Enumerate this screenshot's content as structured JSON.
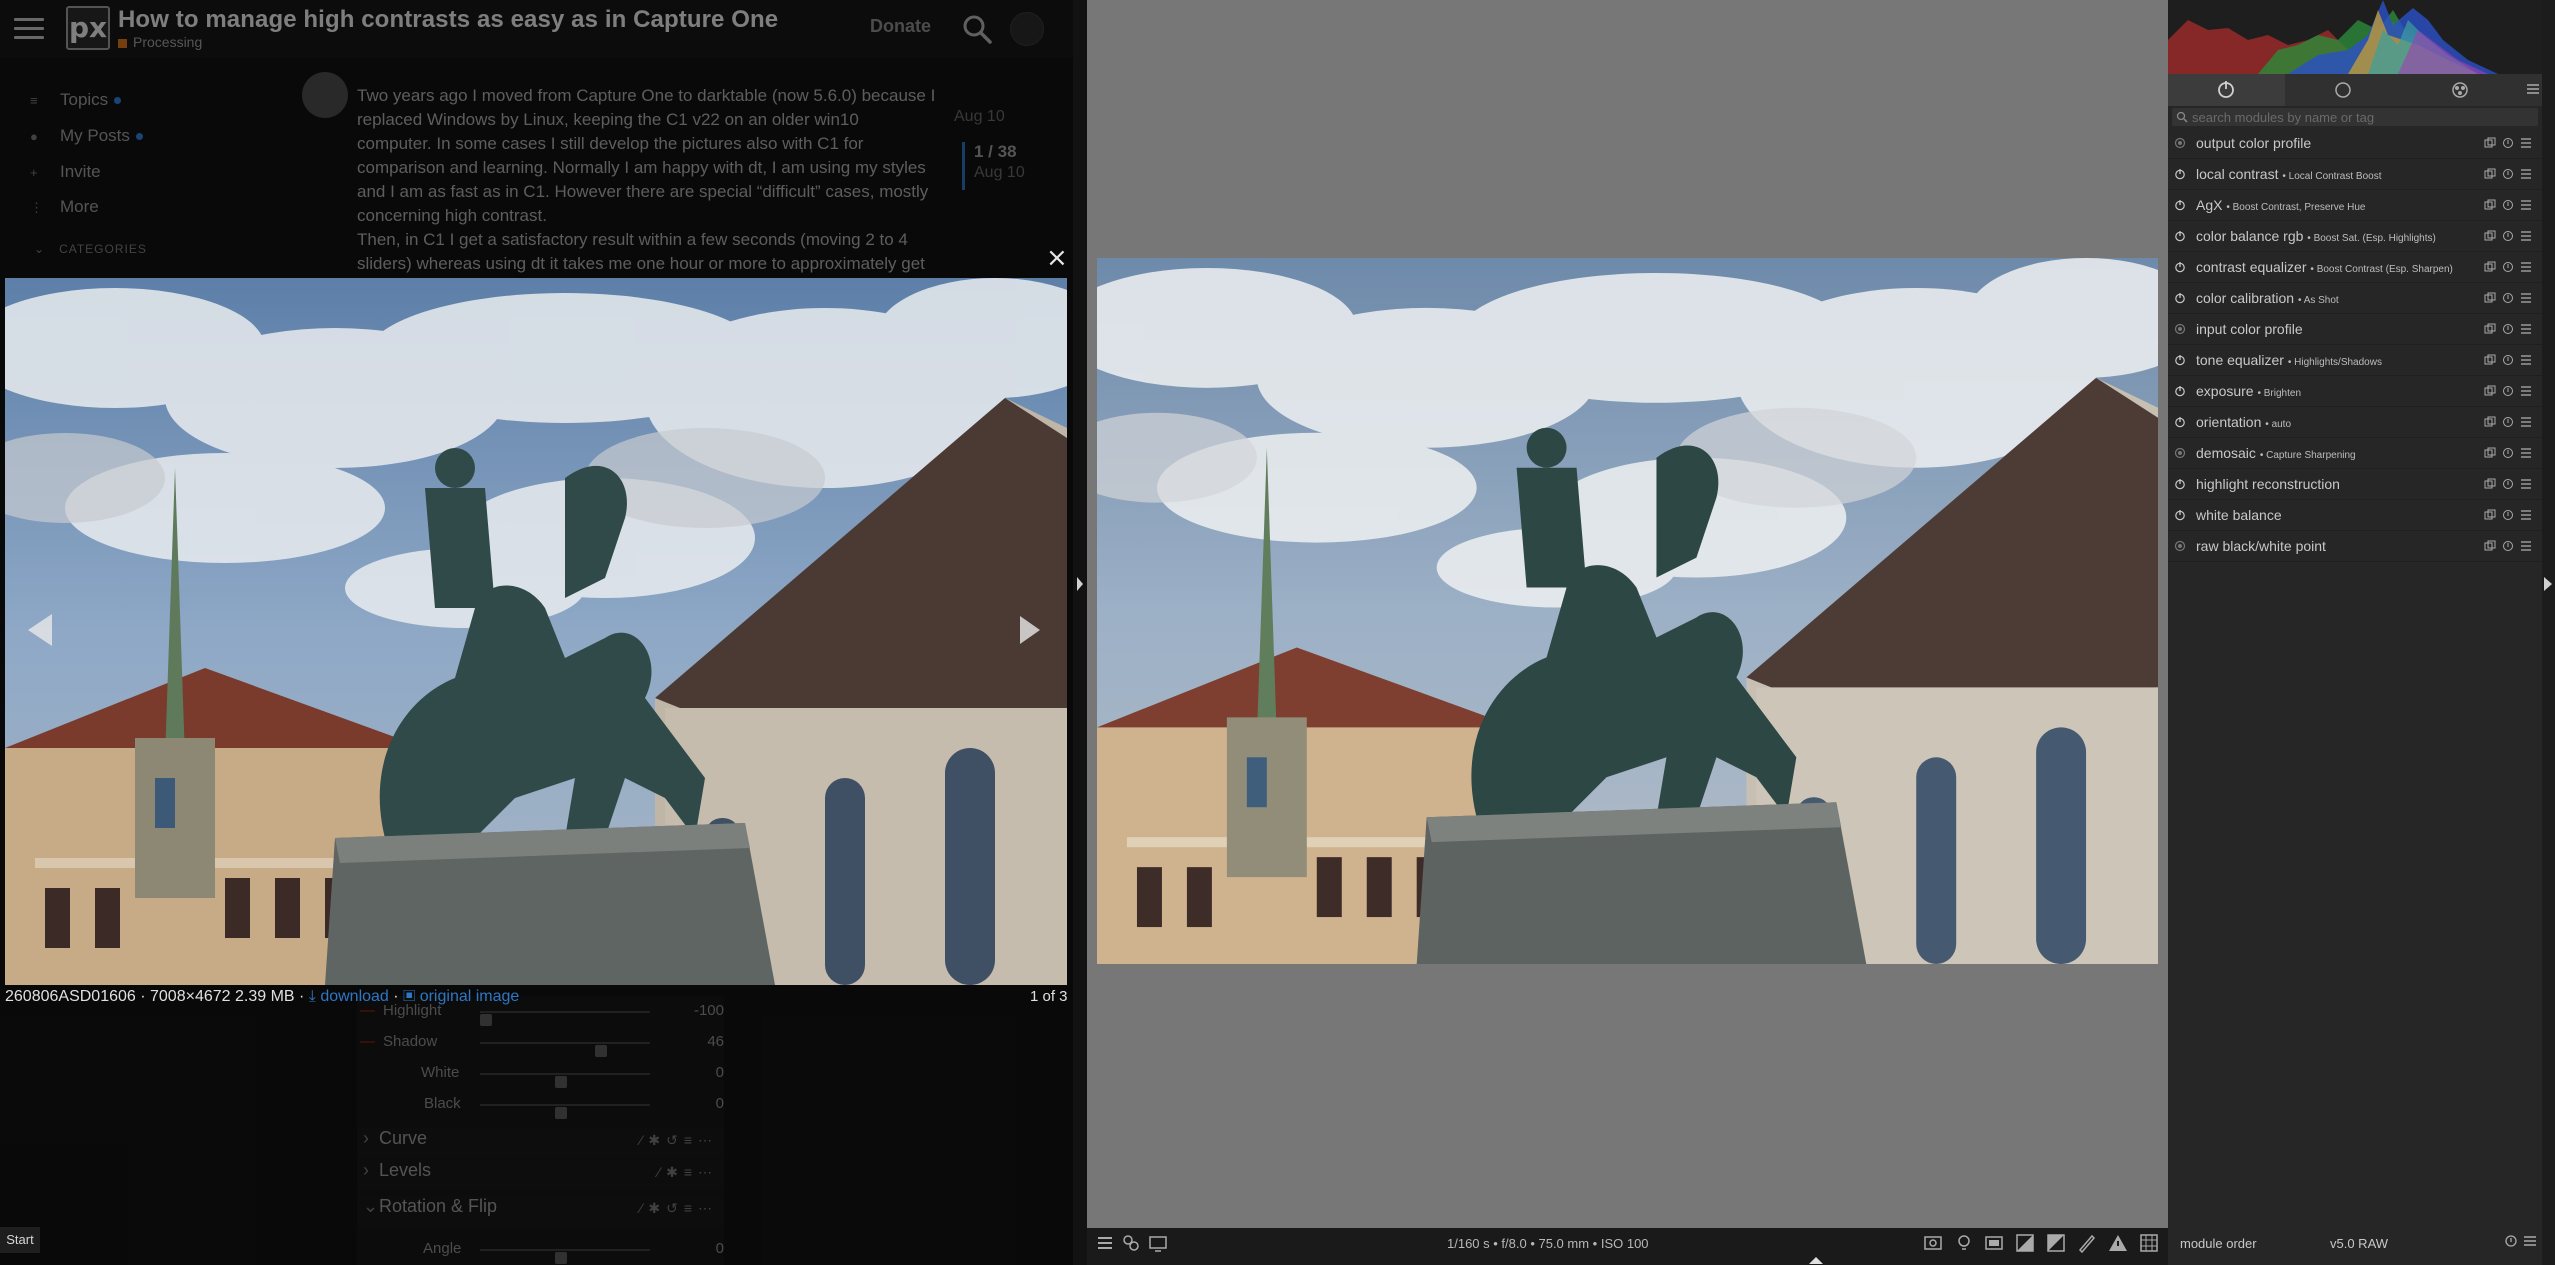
{
  "forum": {
    "logo": "px",
    "title": "How to manage high contrasts as easy as in Capture One",
    "category": "Processing",
    "donate": "Donate",
    "nav": [
      {
        "label": "Topics"
      },
      {
        "label": "My Posts"
      },
      {
        "label": "Invite"
      },
      {
        "label": "More"
      }
    ],
    "categories_label": "CATEGORIES",
    "post": {
      "p1": "Two years ago I moved from Capture One to darktable (now 5.6.0) because I replaced Windows by Linux, keeping the C1 v22 on an older win10 computer. In some cases I still develop the pictures also with C1 for comparison and learning. Normally I am happy with dt, I am using my styles and I am as fast as in C1. However there are special “difficult” cases, mostly concerning high contrast.",
      "p2": "Then, in C1 I get a satisfactory result within a few seconds (moving 2 to 4 sliders) whereas using dt it takes me one hour or more to approximately get",
      "date": "Aug 10"
    },
    "timeline": {
      "position": "1 / 38",
      "date": "Aug 10"
    },
    "dt_sliders": [
      {
        "label": "Highlight",
        "value": "-100",
        "level": 0.0
      },
      {
        "label": "Shadow",
        "value": "46",
        "level": 0.6
      },
      {
        "label": "White",
        "value": "0",
        "level": 0.4
      },
      {
        "label": "Black",
        "value": "0",
        "level": 0.4
      }
    ],
    "dt_sections": [
      {
        "label": "Curve"
      },
      {
        "label": "Levels"
      },
      {
        "label": "Rotation & Flip"
      }
    ],
    "dt_angle": {
      "label": "Angle",
      "value": "0"
    },
    "start": "Start"
  },
  "lightbox": {
    "close": "×",
    "filename": "260806ASD01606 · 7008×4672 2.39 MB ·",
    "download": "download",
    "sep": "·",
    "original": "original image",
    "counter": "1 of 3"
  },
  "darktable": {
    "exif": "1/160 s • f/8.0 • 75.0 mm • ISO 100",
    "search_placeholder": "search modules by name or tag",
    "modules": [
      {
        "name": "output color profile",
        "preset": "",
        "on": false
      },
      {
        "name": "local contrast",
        "preset": "Local Contrast Boost",
        "on": true
      },
      {
        "name": "AgX",
        "preset": "Boost Contrast, Preserve Hue",
        "on": true
      },
      {
        "name": "color balance rgb",
        "preset": "Boost Sat. (Esp. Highlights)",
        "on": true
      },
      {
        "name": "contrast equalizer",
        "preset": "Boost Contrast (Esp. Sharpen)",
        "on": true
      },
      {
        "name": "color calibration",
        "preset": "As Shot",
        "on": true
      },
      {
        "name": "input color profile",
        "preset": "",
        "on": false
      },
      {
        "name": "tone equalizer",
        "preset": "Highlights/Shadows",
        "on": true
      },
      {
        "name": "exposure",
        "preset": "Brighten",
        "on": true
      },
      {
        "name": "orientation",
        "preset": "auto",
        "on": true
      },
      {
        "name": "demosaic",
        "preset": "Capture Sharpening",
        "on": false
      },
      {
        "name": "highlight reconstruction",
        "preset": "",
        "on": true
      },
      {
        "name": "white balance",
        "preset": "",
        "on": true
      },
      {
        "name": "raw black/white point",
        "preset": "",
        "on": false
      }
    ],
    "module_order_label": "module order",
    "module_order_value": "v5.0 RAW"
  }
}
